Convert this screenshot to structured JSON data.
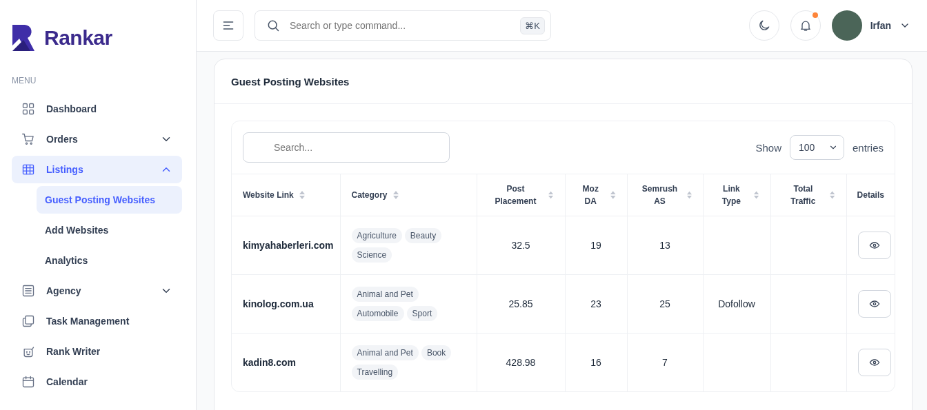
{
  "brand": {
    "name": "Rankar"
  },
  "sidebar": {
    "heading": "MENU",
    "items": [
      {
        "label": "Dashboard",
        "selected": false
      },
      {
        "label": "Orders",
        "selected": false,
        "expanded": false
      },
      {
        "label": "Listings",
        "selected": true,
        "expanded": true,
        "children": [
          {
            "label": "Guest Posting Websites",
            "selected": true
          },
          {
            "label": "Add Websites",
            "selected": false
          },
          {
            "label": "Analytics",
            "selected": false
          }
        ]
      },
      {
        "label": "Agency",
        "selected": false,
        "expanded": false
      },
      {
        "label": "Task Management",
        "selected": false
      },
      {
        "label": "Rank Writer",
        "selected": false
      },
      {
        "label": "Calendar",
        "selected": false
      }
    ]
  },
  "header": {
    "search": {
      "placeholder": "Search or type command..."
    },
    "shortcut": "⌘K",
    "notification_unread": true,
    "user": {
      "name": "Irfan"
    }
  },
  "card": {
    "title": "Guest Posting Websites",
    "table_search": {
      "placeholder": "Search..."
    },
    "show_label": "Show",
    "page_size": "100",
    "entries_label": "entries",
    "columns": [
      {
        "label": "Website Link",
        "sortable": true
      },
      {
        "label": "Category",
        "sortable": true
      },
      {
        "label": "Post Placement",
        "sortable": true
      },
      {
        "label": "Moz DA",
        "sortable": true
      },
      {
        "label": "Semrush AS",
        "sortable": true
      },
      {
        "label": "Link Type",
        "sortable": true
      },
      {
        "label": "Total Traffic",
        "sortable": true
      },
      {
        "label": "Details",
        "sortable": false
      }
    ],
    "rows": [
      {
        "website": "kimyahaberleri.com",
        "categories": [
          "Agriculture",
          "Beauty",
          "Science"
        ],
        "post_placement": "32.5",
        "moz_da": "19",
        "semrush_as": "13"
      },
      {
        "website": "kinolog.com.ua",
        "categories": [
          "Animal and Pet",
          "Automobile",
          "Sport"
        ],
        "post_placement": "25.85",
        "moz_da": "23",
        "semrush_as": "25",
        "link_type": "Dofollow"
      },
      {
        "website": "kadin8.com",
        "categories": [
          "Animal and Pet",
          "Book",
          "Travelling"
        ],
        "post_placement": "428.98",
        "moz_da": "16",
        "semrush_as": "7"
      }
    ]
  }
}
